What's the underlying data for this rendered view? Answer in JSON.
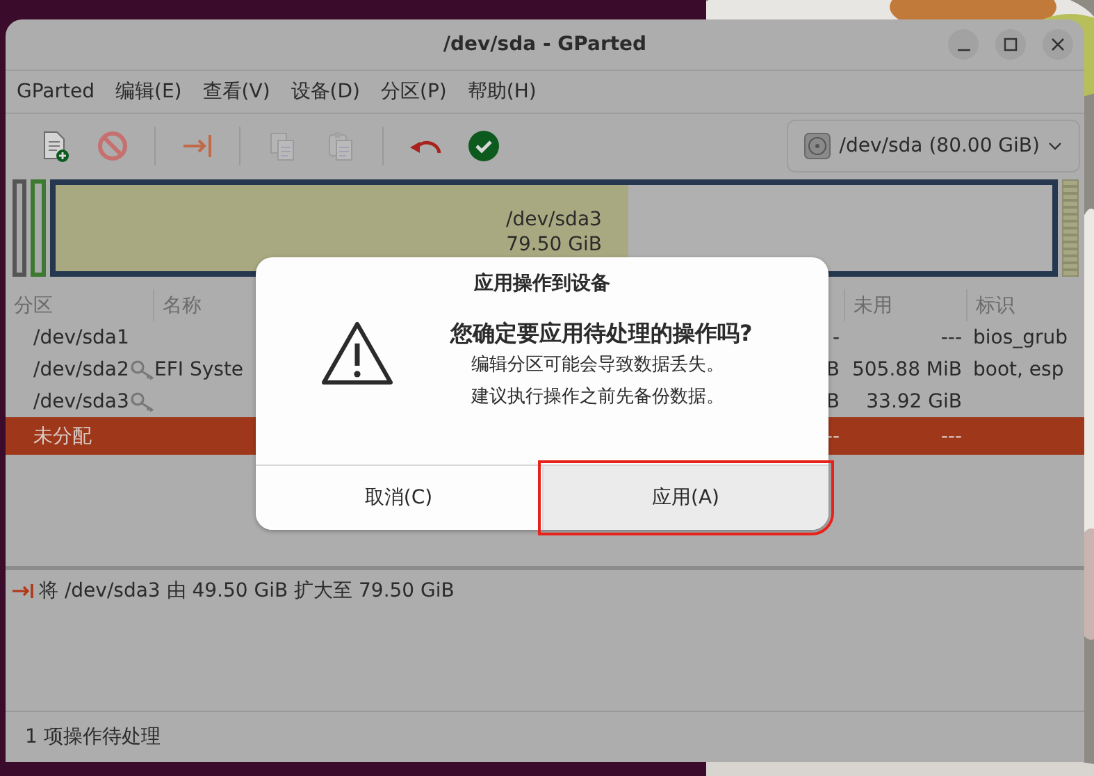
{
  "window": {
    "title": "/dev/sda - GParted"
  },
  "menu": [
    {
      "label": "GParted"
    },
    {
      "label": "编辑(E)"
    },
    {
      "label": "查看(V)"
    },
    {
      "label": "设备(D)"
    },
    {
      "label": "分区(P)"
    },
    {
      "label": "帮助(H)"
    }
  ],
  "toolbar": [
    {
      "kind": "new",
      "disabled": false
    },
    {
      "kind": "delete",
      "disabled": false
    },
    {
      "kind": "resize",
      "disabled": false
    },
    {
      "kind": "copy",
      "disabled": true
    },
    {
      "kind": "paste",
      "disabled": true
    },
    {
      "kind": "undo",
      "disabled": false
    },
    {
      "kind": "apply",
      "disabled": false
    }
  ],
  "device_selector": {
    "label": "/dev/sda (80.00 GiB)"
  },
  "partition_map": {
    "label": "/dev/sda3",
    "size": "79.50 GiB",
    "level": 0.574
  },
  "table": {
    "columns": [
      {
        "label": "分区"
      },
      {
        "label": "名称"
      },
      {
        "label": "未用"
      },
      {
        "label": "标识"
      }
    ],
    "rows": [
      {
        "partition": "/dev/sda1",
        "locked": false,
        "name": "",
        "column_3": "-",
        "unused": "---",
        "flags": "bios_grub",
        "selected": false
      },
      {
        "partition": "/dev/sda2",
        "locked": true,
        "name": "EFI Syste",
        "column_3": "B",
        "unused": "505.88 MiB",
        "flags": "boot, esp",
        "selected": false
      },
      {
        "partition": "/dev/sda3",
        "locked": true,
        "name": "",
        "column_3": "B",
        "unused": "33.92 GiB",
        "flags": "",
        "selected": false
      },
      {
        "partition": "未分配",
        "locked": false,
        "name": "",
        "column_3": "--",
        "unused": "---",
        "flags": "",
        "selected": true
      }
    ]
  },
  "dialog": {
    "title": "应用操作到设备",
    "heading": "您确定要应用待处理的操作吗?",
    "message": [
      "编辑分区可能会导致数据丢失。",
      "建议执行操作之前先备份数据。"
    ],
    "buttons": [
      {
        "label": "取消(C)",
        "selected": false,
        "highlighted": false
      },
      {
        "label": "应用(A)",
        "selected": true,
        "highlighted": true
      }
    ]
  },
  "pending_operations": [
    {
      "text": "将 /dev/sda3 由 49.50 GiB 扩大至 79.50 GiB"
    }
  ],
  "status_bar": {
    "text": "1 项操作待处理"
  }
}
